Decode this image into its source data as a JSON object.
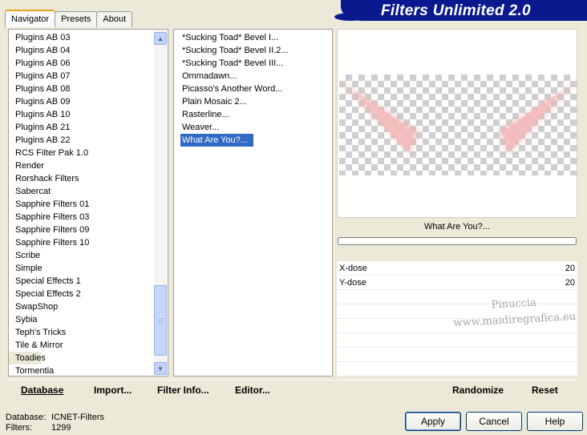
{
  "tabs": [
    {
      "label": "Navigator",
      "active": true
    },
    {
      "label": "Presets",
      "active": false
    },
    {
      "label": "About",
      "active": false
    }
  ],
  "app_title": "Filters Unlimited 2.0",
  "categories": [
    "Plugins AB 03",
    "Plugins AB 04",
    "Plugins AB 06",
    "Plugins AB 07",
    "Plugins AB 08",
    "Plugins AB 09",
    "Plugins AB 10",
    "Plugins AB 21",
    "Plugins AB 22",
    "RCS Filter Pak 1.0",
    "Render",
    "Rorshack Filters",
    "Sabercat",
    "Sapphire Filters 01",
    "Sapphire Filters 03",
    "Sapphire Filters 09",
    "Sapphire Filters 10",
    "Scribe",
    "Simple",
    "Special Effects 1",
    "Special Effects 2",
    "SwapShop",
    "Sybia",
    "Teph's Tricks",
    "Tile & Mirror",
    "Toadies",
    "Tormentia"
  ],
  "current_category": "Toadies",
  "filters": [
    "*Sucking Toad*  Bevel I...",
    "*Sucking Toad*  Bevel II.2...",
    "*Sucking Toad*  Bevel III...",
    "Ommadawn...",
    "Picasso's Another Word...",
    "Plain Mosaic 2...",
    "Rasterline...",
    "Weaver...",
    "What Are You?..."
  ],
  "selected_filter": "What Are You?...",
  "preview": {
    "filter_name": "What Are You?...",
    "progress": 0,
    "params": [
      {
        "label": "X-dose",
        "value": "20"
      },
      {
        "label": "Y-dose",
        "value": "20"
      }
    ],
    "watermark_line1": "Pinuccia",
    "watermark_line2": "www.maidiregrafica.eu"
  },
  "left_buttons": {
    "database": "Database",
    "import": "Import...",
    "filter_info": "Filter Info...",
    "editor": "Editor..."
  },
  "right_buttons": {
    "randomize": "Randomize",
    "reset": "Reset"
  },
  "status": {
    "database_label": "Database:",
    "database_value": "ICNET-Filters",
    "filters_label": "Filters:",
    "filters_value": "1299"
  },
  "dialog_buttons": {
    "apply": "Apply",
    "cancel": "Cancel",
    "help": "Help"
  }
}
